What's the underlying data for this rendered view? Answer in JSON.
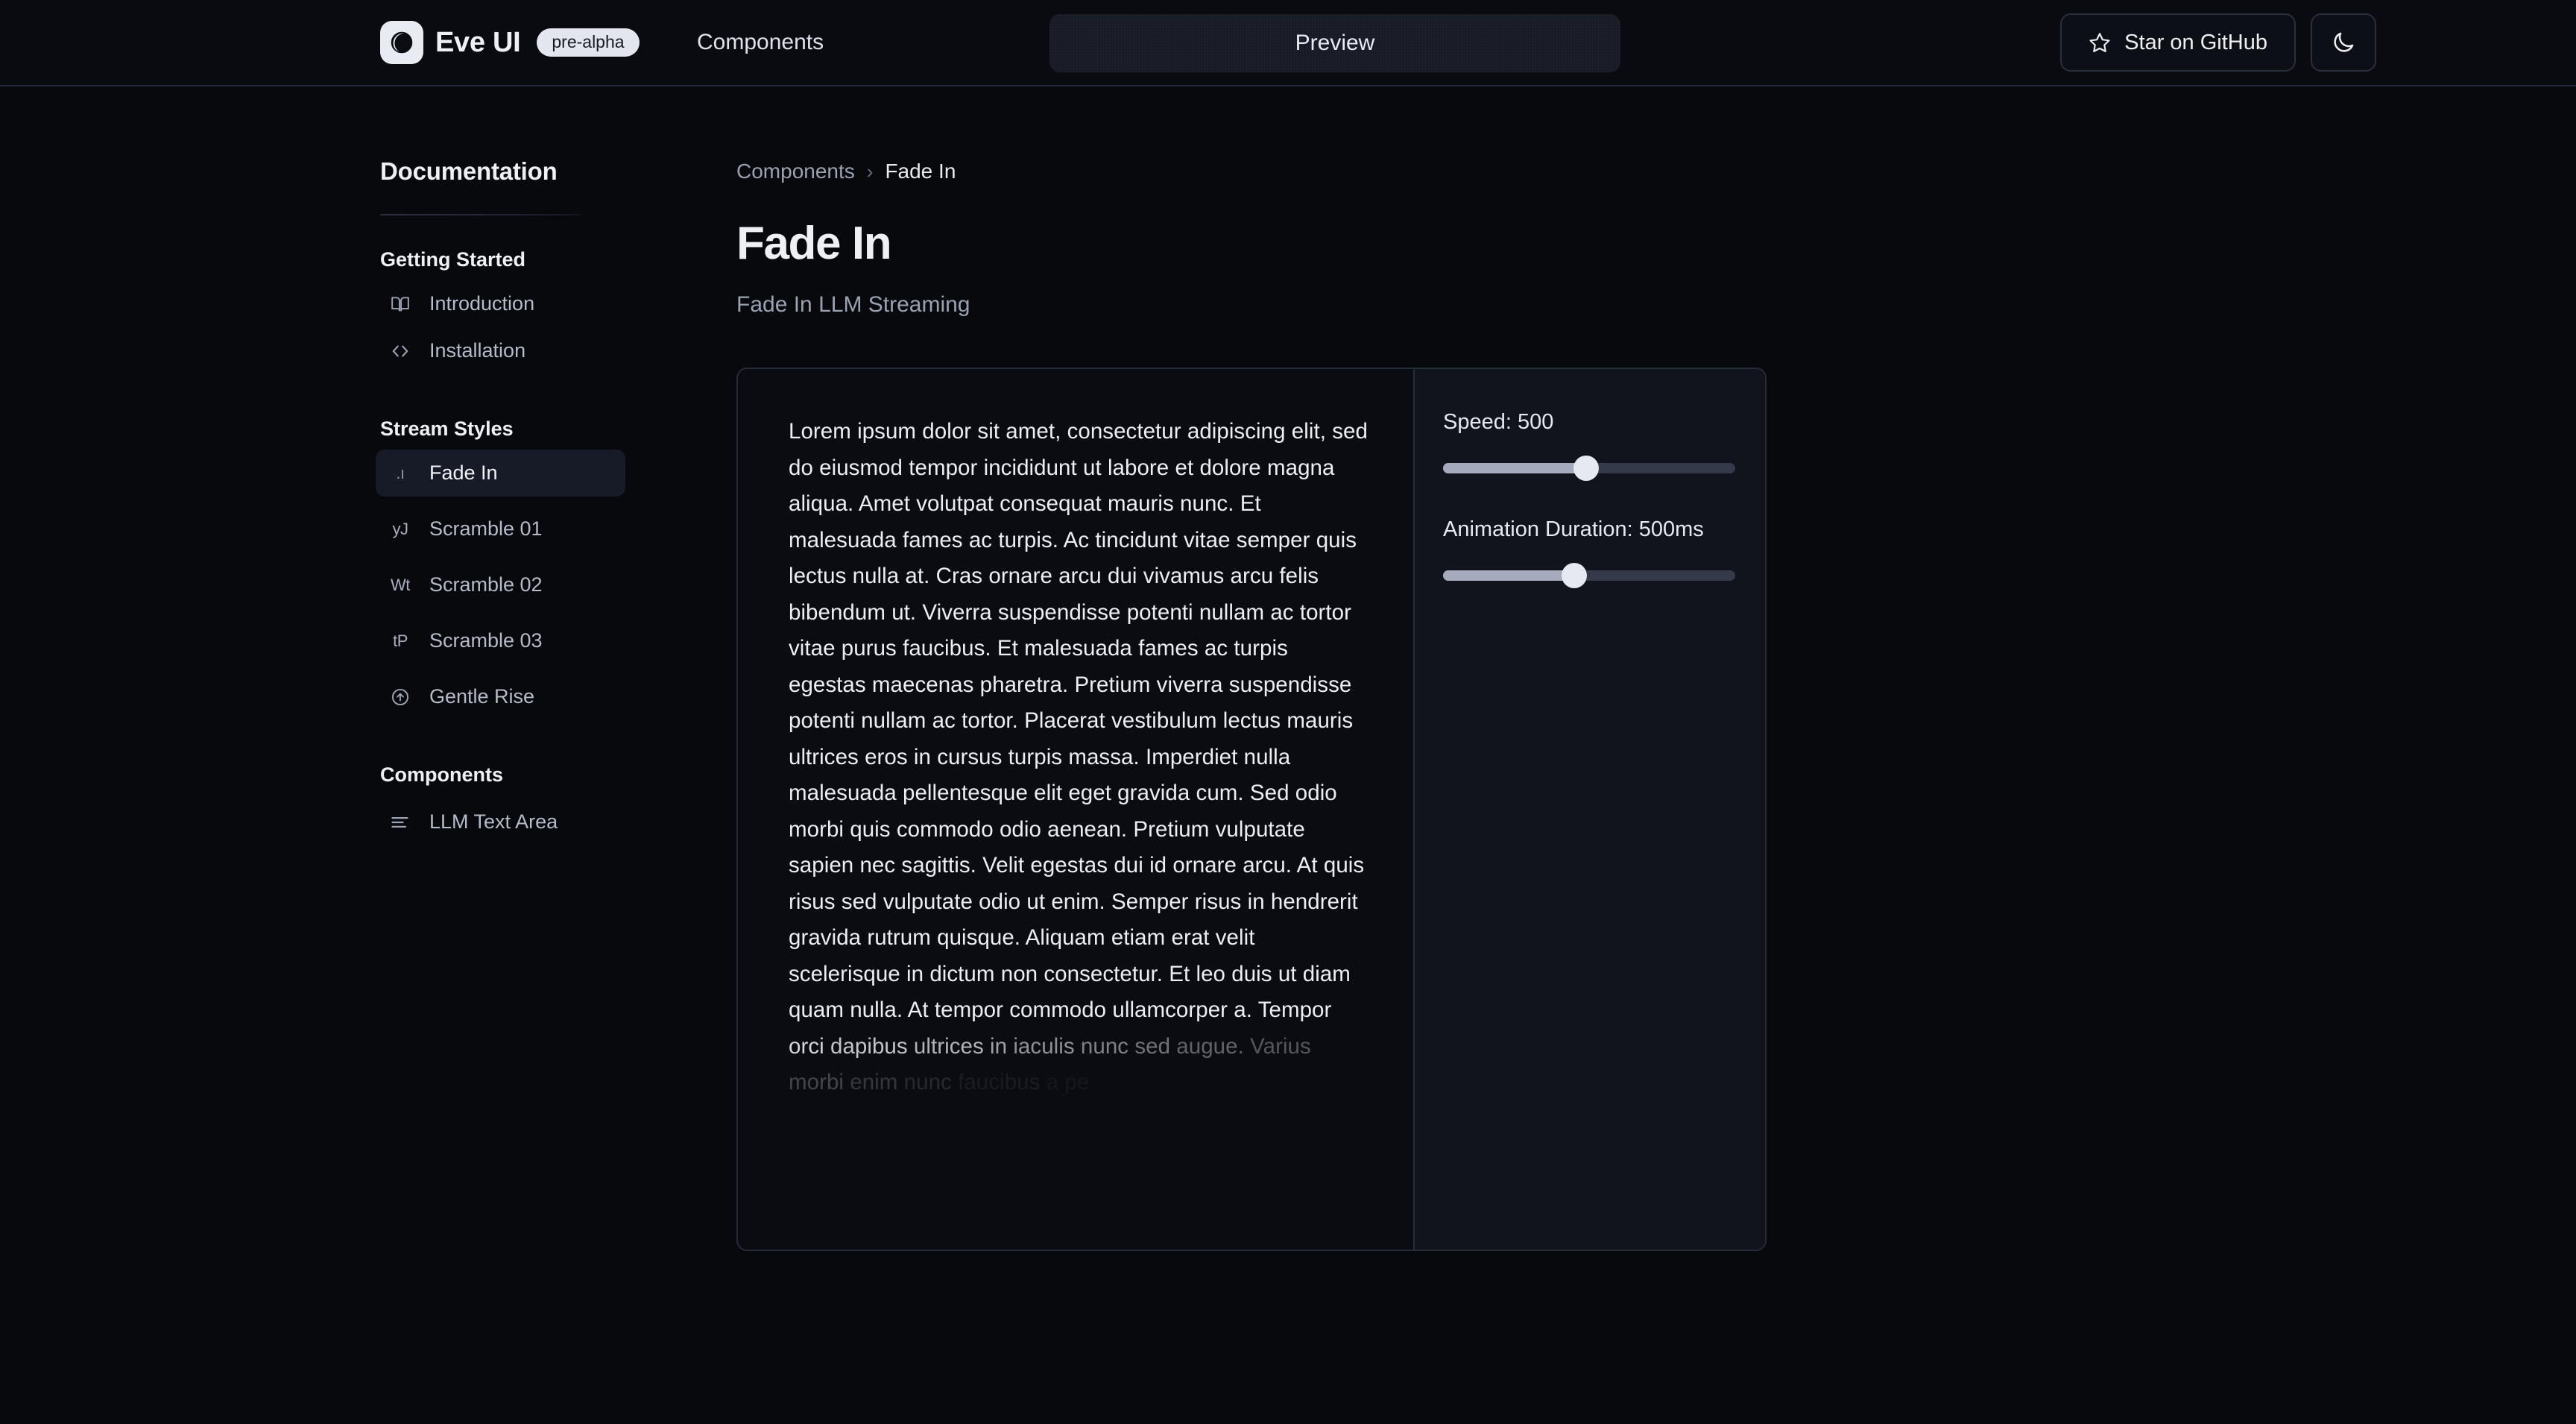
{
  "header": {
    "logo_icon": "moon-logo-icon",
    "brand": "Eve UI",
    "badge": "pre-alpha",
    "nav_link": "Components",
    "preview_label": "Preview",
    "github_icon": "star-icon",
    "github_label": "Star on GitHub",
    "theme_toggle_icon": "moon-icon"
  },
  "sidebar": {
    "title": "Documentation",
    "sections": [
      {
        "title": "Getting Started",
        "items": [
          {
            "label": "Introduction",
            "icon": "book-open-icon",
            "active": false
          },
          {
            "label": "Installation",
            "icon": "code-brackets-icon",
            "active": false
          }
        ]
      },
      {
        "title": "Stream Styles",
        "items": [
          {
            "label": "Fade In",
            "icon": "fade-in-icon",
            "icon_text": ".ı",
            "active": true
          },
          {
            "label": "Scramble 01",
            "icon": "scramble-01-icon",
            "icon_text": "yJ",
            "active": false
          },
          {
            "label": "Scramble 02",
            "icon": "scramble-02-icon",
            "icon_text": "Wt",
            "active": false
          },
          {
            "label": "Scramble 03",
            "icon": "scramble-03-icon",
            "icon_text": "tP",
            "active": false
          },
          {
            "label": "Gentle Rise",
            "icon": "arrow-up-circle-icon",
            "active": false
          }
        ]
      },
      {
        "title": "Components",
        "items": [
          {
            "label": "LLM Text Area",
            "icon": "text-lines-icon",
            "active": false
          }
        ]
      }
    ]
  },
  "main": {
    "breadcrumb": {
      "parent": "Components",
      "separator": "›",
      "current": "Fade In"
    },
    "title": "Fade In",
    "subtitle": "Fade In LLM Streaming"
  },
  "demo": {
    "body_text": "Lorem ipsum dolor sit amet, consectetur adipiscing elit, sed do eiusmod tempor incididunt ut labore et dolore magna aliqua. Amet volutpat consequat mauris nunc. Et malesuada fames ac turpis. Ac tincidunt vitae semper quis lectus nulla at. Cras ornare arcu dui vivamus arcu felis bibendum ut. Viverra suspendisse potenti nullam ac tortor vitae purus faucibus. Et malesuada fames ac turpis egestas maecenas pharetra. Pretium viverra suspendisse potenti nullam ac tortor. Placerat vestibulum lectus mauris ultrices eros in cursus turpis massa. Imperdiet nulla malesuada pellentesque elit eget gravida cum. Sed odio morbi quis commodo odio aenean. Pretium vulputate sapien nec sagittis. Velit egestas dui id ornare arcu. At quis risus sed vulputate odio ut enim. Semper risus in hendrerit gravida rutrum quisque. Aliquam etiam erat velit scelerisque in dictum non consectetur. Et leo duis ut diam quam nulla. At tempor commodo ullamcorper a.",
    "fading_text": "Tempor orci dapibus ultrices in iaculis nunc sed augue. Varius morbi enim nunc faucibus a pe",
    "controls": [
      {
        "label": "Speed: 500",
        "name": "speed-slider",
        "value": 500,
        "fill_percent": 49
      },
      {
        "label": "Animation Duration: 500ms",
        "name": "animation-duration-slider",
        "value": 500,
        "fill_percent": 45
      }
    ]
  },
  "colors": {
    "background": "#08090d",
    "panel": "#11141c",
    "border": "#252b39",
    "text_primary": "#eef0f6",
    "text_muted": "#9aa1b1",
    "accent_light": "#e9ebf3"
  }
}
